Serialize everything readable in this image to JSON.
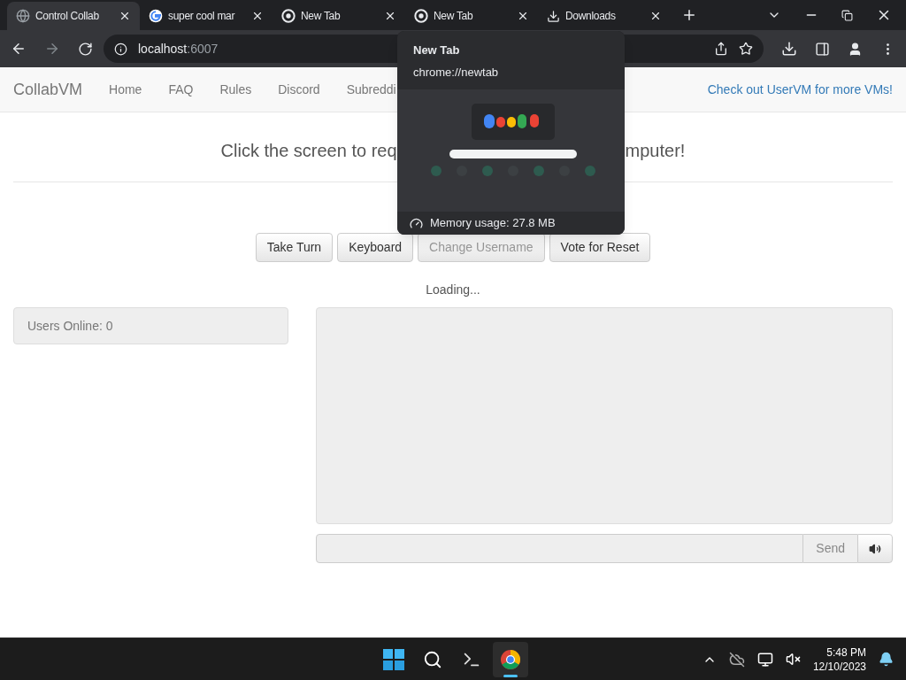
{
  "browser": {
    "tabs": [
      {
        "label": "Control Collab",
        "kind": "globe",
        "selected": true
      },
      {
        "label": "super cool mar",
        "kind": "google",
        "selected": false
      },
      {
        "label": "New Tab",
        "kind": "chrome",
        "selected": false
      },
      {
        "label": "New Tab",
        "kind": "chrome",
        "selected": false
      },
      {
        "label": "Downloads",
        "kind": "download",
        "selected": false
      }
    ],
    "address": {
      "host": "localhost",
      "port": ":6007"
    }
  },
  "page": {
    "brand": "CollabVM",
    "nav": [
      "Home",
      "FAQ",
      "Rules",
      "Discord",
      "Subreddi"
    ],
    "nav_link": "Check out UserVM for more VMs!",
    "heading_left": "Click the screen to req",
    "heading_right": "mputer!",
    "buttons": [
      {
        "label": "Take Turn",
        "disabled": false
      },
      {
        "label": "Keyboard",
        "disabled": false
      },
      {
        "label": "Change Username",
        "disabled": true
      },
      {
        "label": "Vote for Reset",
        "disabled": false
      }
    ],
    "status": "Loading...",
    "users_online": "Users Online: 0",
    "send": "Send"
  },
  "hover_card": {
    "title": "New Tab",
    "url": "chrome://newtab",
    "memory": "Memory usage: 27.8 MB"
  },
  "taskbar": {
    "apps": [
      {
        "kind": "start",
        "selected": false
      },
      {
        "kind": "search",
        "selected": false
      },
      {
        "kind": "terminal",
        "selected": false
      },
      {
        "kind": "chrome",
        "selected": true
      }
    ],
    "time": "5:48 PM",
    "date": "12/10/2023"
  }
}
